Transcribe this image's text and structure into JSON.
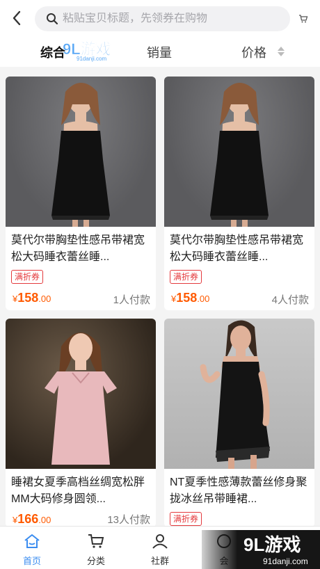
{
  "header": {
    "search_placeholder": "粘贴宝贝标题，先领券在购物"
  },
  "tabs": [
    {
      "label": "综合",
      "active": true
    },
    {
      "label": "销量",
      "active": false
    },
    {
      "label": "价格",
      "active": false
    }
  ],
  "products": [
    {
      "title": "莫代尔带胸垫性感吊带裙宽松大码睡衣蕾丝睡...",
      "coupon": "满折券",
      "currency": "¥",
      "price_int": "158",
      "price_dec": ".00",
      "sold": "1人付款"
    },
    {
      "title": "莫代尔带胸垫性感吊带裙宽松大码睡衣蕾丝睡...",
      "coupon": "满折券",
      "currency": "¥",
      "price_int": "158",
      "price_dec": ".00",
      "sold": "4人付款"
    },
    {
      "title": "睡裙女夏季高档丝绸宽松胖MM大码修身圆领...",
      "coupon": "",
      "currency": "¥",
      "price_int": "166",
      "price_dec": ".00",
      "sold": "13人付款"
    },
    {
      "title": "NT夏季性感薄款蕾丝修身聚拢冰丝吊带睡裙...",
      "coupon": "满折券",
      "currency": "",
      "price_int": "",
      "price_dec": "",
      "sold": ""
    }
  ],
  "bottom_nav": [
    {
      "label": "首页",
      "icon": "home-icon",
      "active": true
    },
    {
      "label": "分类",
      "icon": "cart-icon",
      "active": false
    },
    {
      "label": "社群",
      "icon": "user-icon",
      "active": false
    },
    {
      "label": "会",
      "icon": "member-icon",
      "active": false
    }
  ],
  "watermark": {
    "logo_text": "9L游戏",
    "site": "91danji.com"
  },
  "colors": {
    "accent": "#3a8cf0",
    "price": "#ff5a00",
    "coupon": "#e4393c"
  }
}
